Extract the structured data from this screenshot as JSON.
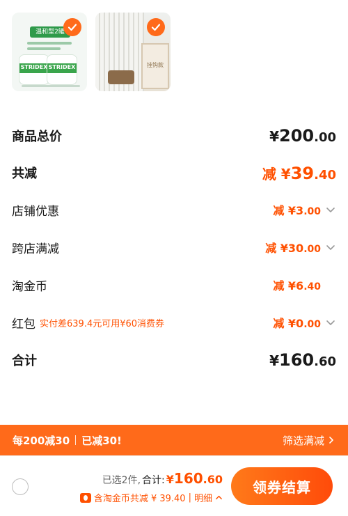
{
  "products": [
    {
      "art_text_tag": "温和型2罐",
      "art_text_brand": "STRIDEX"
    },
    {
      "art_text_frame": "挂钩款"
    }
  ],
  "summary": {
    "goods_total_label": "商品总价",
    "goods_total_yen": "¥",
    "goods_total_int": "200",
    "goods_total_dec": ".00",
    "total_off_label": "共减",
    "total_off_prefix": "减 ¥",
    "total_off_int": "39",
    "total_off_dec": ".40"
  },
  "discounts": [
    {
      "label": "店铺优惠",
      "prefix": "减 ¥",
      "int": "3",
      "dec": ".00",
      "has_chevron": true
    },
    {
      "label": "跨店满减",
      "prefix": "减 ¥",
      "int": "30",
      "dec": ".00",
      "has_chevron": true
    },
    {
      "label": "淘金币",
      "prefix": "减 ¥",
      "int": "6",
      "dec": ".40",
      "has_chevron": false
    },
    {
      "label": "红包",
      "note": "实付差639.4元可用¥60消费券",
      "prefix": "减 ¥",
      "int": "0",
      "dec": ".00",
      "has_chevron": true
    }
  ],
  "grand_total": {
    "label": "合计",
    "yen": "¥",
    "int": "160",
    "dec": ".60"
  },
  "promo_bar": {
    "left_text1": "每200减30",
    "left_text2": "已减30!",
    "right_text": "筛选满减",
    "right_icon": "chevron-right-icon"
  },
  "bottom_bar": {
    "selected_text": "已选2件,",
    "total_label": "合计:",
    "total_yen": "¥",
    "total_int": "160",
    "total_dec": ".60",
    "coin_text": "含淘金币共减 ¥ 39.40",
    "detail_text": "明细",
    "checkout_label": "领券结算"
  },
  "colors": {
    "accent": "#ff5000",
    "promo_bg": "#ff6a1a"
  }
}
